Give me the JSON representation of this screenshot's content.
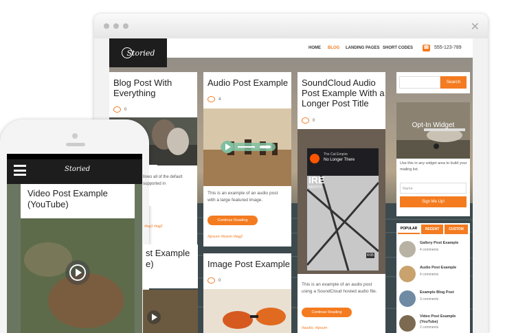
{
  "brand": {
    "name": "Storied",
    "accent": "#f47b20"
  },
  "nav": {
    "items": [
      "HOME",
      "BLOG",
      "LANDING PAGES",
      "SHORT CODES"
    ]
  },
  "phone_number": "555-123-789",
  "posts": [
    {
      "title": "Blog Post With Everything",
      "comments": "0"
    },
    {
      "title": "Audio Post Example",
      "comments": "4",
      "excerpt": "This is an example of an audio post with a large featured image.",
      "button": "Continue Reading",
      "tags": "#ipsum #lorem #tag2"
    },
    {
      "title": "SoundCloud Audio Post Example With a Longer Post Title",
      "comments": "0",
      "excerpt": "This is an example of an audio post using a SoundCloud hosted audio file.",
      "button": "Continue Reading",
      "tags": "#audio, #ipsum"
    },
    {
      "title": "Image Post Example",
      "comments": "0"
    }
  ],
  "soundcloud": {
    "user": "The Cat Empire",
    "track": "No Longer There",
    "art_text": "IRE",
    "art_sub": "NIGHTS",
    "time": "4:05"
  },
  "sidebar": {
    "search_button": "Search",
    "optin_title": "Opt-In Widget",
    "optin_text": "Use this in any widget area to build your mailing list.",
    "name_placeholder": "Name",
    "signup_button": "Sign Me Up!",
    "tabs": [
      "POPULAR",
      "RECENT",
      "CUSTOM"
    ],
    "popular": [
      {
        "title": "Gallery Post Example",
        "meta": "4 comments"
      },
      {
        "title": "Audio Post Example",
        "meta": "4 comments"
      },
      {
        "title": "Example Blog Post",
        "meta": "3 comments"
      },
      {
        "title": "Video Post Example (YouTube)",
        "meta": "2 comments"
      }
    ]
  },
  "mobile": {
    "title": "Video Post Example (YouTube)",
    "peek_excerpt": "llows all of the default supported in",
    "peek_title": "st Example",
    "peek_title2": "e)",
    "peek_tags": "#tag1 #tag2"
  }
}
